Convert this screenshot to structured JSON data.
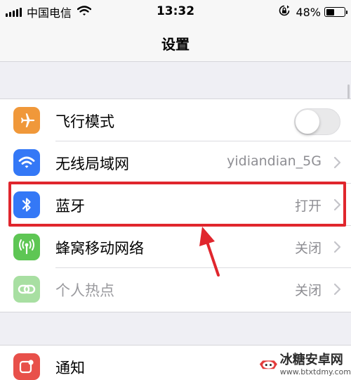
{
  "status_bar": {
    "carrier": "中国电信",
    "time": "13:32",
    "battery_percent": "48%",
    "battery_level": 0.48,
    "icons": [
      "signal-icon",
      "wifi-icon",
      "rotation-lock-icon",
      "battery-icon"
    ]
  },
  "nav": {
    "title": "设置"
  },
  "settings": {
    "airplane": {
      "label": "飞行模式",
      "icon": "airplane-icon",
      "color": "#f0983a",
      "toggle_on": false
    },
    "wifi": {
      "label": "无线局域网",
      "value": "yidiandian_5G",
      "icon": "wifi-icon",
      "color": "#3478f6"
    },
    "bluetooth": {
      "label": "蓝牙",
      "value": "打开",
      "icon": "bluetooth-icon",
      "color": "#3478f6"
    },
    "cellular": {
      "label": "蜂窝移动网络",
      "value": "关闭",
      "icon": "cellular-antenna-icon",
      "color": "#5ec654"
    },
    "hotspot": {
      "label": "个人热点",
      "value": "关闭",
      "icon": "hotspot-link-icon",
      "color": "#a8dfa2"
    },
    "notifications": {
      "label": "通知",
      "icon": "notifications-icon",
      "color": "#e8504a"
    }
  },
  "annotation": {
    "highlight_color": "#e0262d"
  },
  "watermark": {
    "name": "冰糖安卓网",
    "url": "www.btxtdmy.com"
  }
}
